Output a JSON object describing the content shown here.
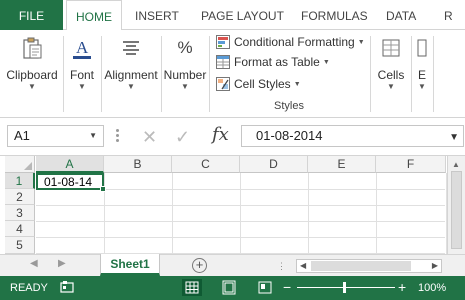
{
  "ribbon_tabs": {
    "file": "FILE",
    "home": "HOME",
    "insert": "INSERT",
    "page_layout": "PAGE LAYOUT",
    "formulas": "FORMULAS",
    "data": "DATA",
    "more": "R"
  },
  "ribbon_groups": {
    "clipboard": "Clipboard",
    "font": "Font",
    "alignment": "Alignment",
    "number": "Number",
    "cells": "Cells",
    "editing": "E",
    "styles": {
      "conditional_formatting": "Conditional Formatting",
      "format_as_table": "Format as Table",
      "cell_styles": "Cell Styles",
      "group_label": "Styles"
    },
    "font_icon_letter": "A",
    "number_icon": "%"
  },
  "formula_bar": {
    "name_box": "A1",
    "fx_label": "fx",
    "value": "01-08-2014"
  },
  "grid": {
    "columns": [
      "A",
      "B",
      "C",
      "D",
      "E",
      "F"
    ],
    "rows": [
      "1",
      "2",
      "3",
      "4",
      "5"
    ],
    "selected_cell": "A1",
    "cells": {
      "A1": "01-08-14"
    }
  },
  "sheet_tabs": {
    "active": "Sheet1",
    "add_symbol": "+"
  },
  "status_bar": {
    "state": "READY",
    "zoom": "100%",
    "zoom_fraction": 0.5
  },
  "colors": {
    "accent": "#217346",
    "status_bar": "#217346"
  }
}
